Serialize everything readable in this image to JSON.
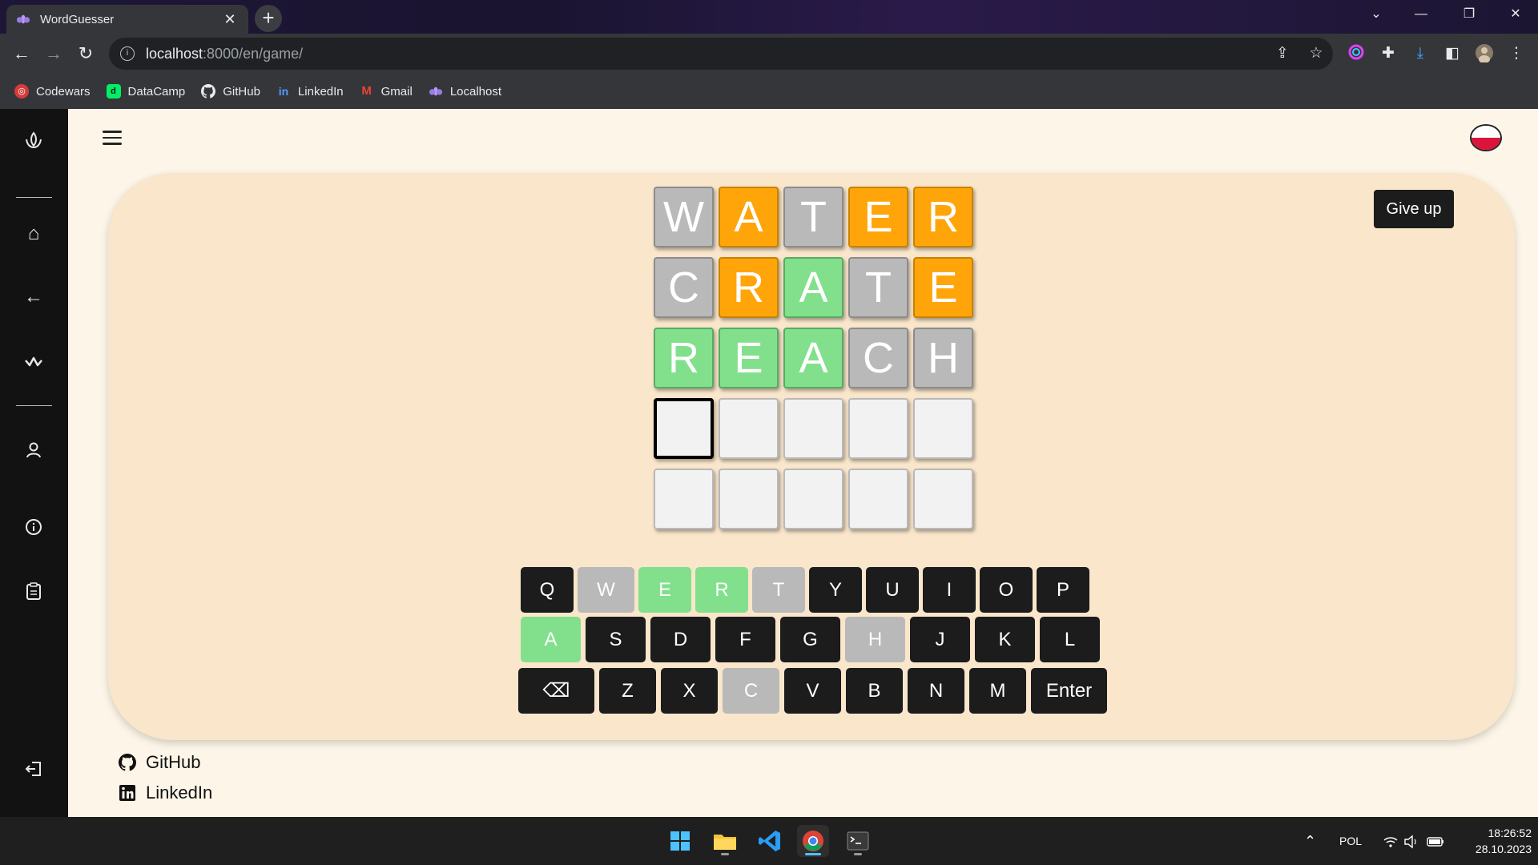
{
  "browser": {
    "tab_title": "WordGuesser",
    "tab_close": "✕",
    "new_tab": "+",
    "url_host": "localhost",
    "url_path": ":8000/en/game/",
    "bookmarks": [
      {
        "label": "Codewars",
        "icon": "codewars-icon",
        "color": "#d33c3c"
      },
      {
        "label": "DataCamp",
        "icon": "datacamp-icon",
        "color": "#03ef62"
      },
      {
        "label": "GitHub",
        "icon": "github-icon",
        "color": "#24292e"
      },
      {
        "label": "LinkedIn",
        "icon": "linkedin-icon",
        "color": "#0a66c2"
      },
      {
        "label": "Gmail",
        "icon": "gmail-icon",
        "color": "#ea4335"
      },
      {
        "label": "Localhost",
        "icon": "lotus-icon",
        "color": "#9b7be8"
      }
    ]
  },
  "game": {
    "give_up_label": "Give up",
    "board": [
      [
        {
          "l": "W",
          "s": "gray"
        },
        {
          "l": "A",
          "s": "orange"
        },
        {
          "l": "T",
          "s": "gray"
        },
        {
          "l": "E",
          "s": "orange"
        },
        {
          "l": "R",
          "s": "orange"
        }
      ],
      [
        {
          "l": "C",
          "s": "gray"
        },
        {
          "l": "R",
          "s": "orange"
        },
        {
          "l": "A",
          "s": "green"
        },
        {
          "l": "T",
          "s": "gray"
        },
        {
          "l": "E",
          "s": "orange"
        }
      ],
      [
        {
          "l": "R",
          "s": "green"
        },
        {
          "l": "E",
          "s": "green"
        },
        {
          "l": "A",
          "s": "green"
        },
        {
          "l": "C",
          "s": "gray"
        },
        {
          "l": "H",
          "s": "gray"
        }
      ],
      [
        {
          "l": "",
          "s": "active"
        },
        {
          "l": "",
          "s": "empty"
        },
        {
          "l": "",
          "s": "empty"
        },
        {
          "l": "",
          "s": "empty"
        },
        {
          "l": "",
          "s": "empty"
        }
      ],
      [
        {
          "l": "",
          "s": "empty"
        },
        {
          "l": "",
          "s": "empty"
        },
        {
          "l": "",
          "s": "empty"
        },
        {
          "l": "",
          "s": "empty"
        },
        {
          "l": "",
          "s": "empty"
        }
      ]
    ],
    "keyboard": [
      [
        {
          "k": "Q",
          "s": "dark"
        },
        {
          "k": "W",
          "s": "gray"
        },
        {
          "k": "E",
          "s": "green"
        },
        {
          "k": "R",
          "s": "green"
        },
        {
          "k": "T",
          "s": "gray"
        },
        {
          "k": "Y",
          "s": "dark"
        },
        {
          "k": "U",
          "s": "dark"
        },
        {
          "k": "I",
          "s": "dark"
        },
        {
          "k": "O",
          "s": "dark"
        },
        {
          "k": "P",
          "s": "dark"
        }
      ],
      [
        {
          "k": "A",
          "s": "green"
        },
        {
          "k": "S",
          "s": "dark"
        },
        {
          "k": "D",
          "s": "dark"
        },
        {
          "k": "F",
          "s": "dark"
        },
        {
          "k": "G",
          "s": "dark"
        },
        {
          "k": "H",
          "s": "gray"
        },
        {
          "k": "J",
          "s": "dark"
        },
        {
          "k": "K",
          "s": "dark"
        },
        {
          "k": "L",
          "s": "dark"
        }
      ],
      [
        {
          "k": "⌫",
          "s": "dark"
        },
        {
          "k": "Z",
          "s": "dark"
        },
        {
          "k": "X",
          "s": "dark"
        },
        {
          "k": "C",
          "s": "gray"
        },
        {
          "k": "V",
          "s": "dark"
        },
        {
          "k": "B",
          "s": "dark"
        },
        {
          "k": "N",
          "s": "dark"
        },
        {
          "k": "M",
          "s": "dark"
        },
        {
          "k": "Enter",
          "s": "dark"
        }
      ]
    ]
  },
  "footer": {
    "github_label": "GitHub",
    "linkedin_label": "LinkedIn"
  },
  "taskbar": {
    "language": "POL",
    "time": "18:26:52",
    "date": "28.10.2023"
  },
  "colors": {
    "tile_gray": "#b9b9b9",
    "tile_orange": "#ffa50a",
    "tile_green": "#82e08c",
    "key_dark": "#1c1c1c",
    "sidebar_bg": "#121212",
    "game_bg": "#f9e6cb",
    "page_bg": "#fdf6e8"
  }
}
